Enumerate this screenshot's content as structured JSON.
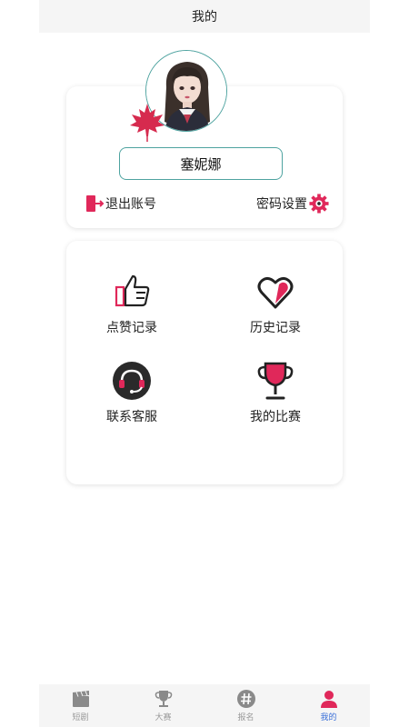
{
  "header": {
    "title": "我的"
  },
  "profile": {
    "username": "塞妮娜",
    "logout_label": "退出账号",
    "password_label": "密码设置"
  },
  "menu": {
    "items": [
      {
        "label": "点赞记录",
        "icon": "thumbs-up-icon"
      },
      {
        "label": "历史记录",
        "icon": "heart-icon"
      },
      {
        "label": "联系客服",
        "icon": "headset-icon"
      },
      {
        "label": "我的比赛",
        "icon": "trophy-icon"
      }
    ]
  },
  "tabbar": {
    "tabs": [
      {
        "label": "短剧",
        "icon": "clapperboard-icon",
        "active": false
      },
      {
        "label": "大赛",
        "icon": "trophy-icon",
        "active": false
      },
      {
        "label": "报名",
        "icon": "hashtag-icon",
        "active": false
      },
      {
        "label": "我的",
        "icon": "person-icon",
        "active": true
      }
    ]
  },
  "colors": {
    "accent": "#e0285a",
    "teal_border": "#4ea3a0",
    "active_tab": "#3a6fd8",
    "icon_dark": "#2a2a2a"
  }
}
